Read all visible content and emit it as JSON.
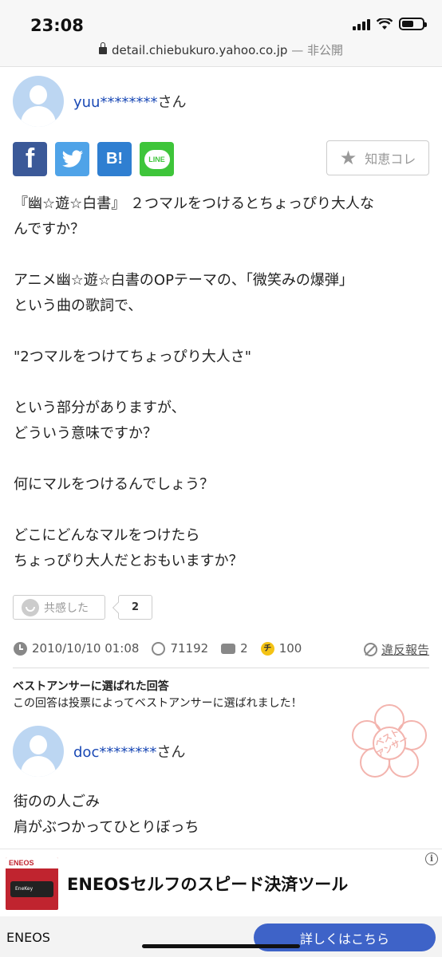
{
  "status_bar": {
    "time": "23:08"
  },
  "url_bar": {
    "domain": "detail.chiebukuro.yahoo.co.jp",
    "suffix": "— 非公開"
  },
  "question": {
    "user_id": "yuu********",
    "honorific": "さん",
    "chie_button_label": "知恵コレ",
    "share_labels": {
      "facebook": "f",
      "twitter": "t",
      "hatena": "B!",
      "line": "LINE"
    },
    "paragraphs": [
      [
        "『幽☆遊☆白書』 ２つマルをつけるとちょっぴり大人な",
        "んですか？"
      ],
      [
        "アニメ幽☆遊☆白書のOPテーマの、「微笑みの爆弾」",
        "という曲の歌詞で、"
      ],
      [
        "\"2つマルをつけてちょっぴり大人さ\""
      ],
      [
        "という部分がありますが、",
        "どういう意味ですか？"
      ],
      [
        "何にマルをつけるんでしょう？"
      ],
      [
        "どこにどんなマルをつけたら",
        "ちょっぴり大人だとおもいますか？"
      ]
    ],
    "empathy_label": "共感した",
    "empathy_count": "2",
    "date": "2010/10/10 01:08",
    "views": "71192",
    "answers": "2",
    "coin_symbol": "チ",
    "coins": "100",
    "report_label": "違反報告"
  },
  "best_answer": {
    "title": "ベストアンサーに選ばれた回答",
    "subtitle": "この回答は投票によってベストアンサーに選ばれました！",
    "user_id": "doc********",
    "honorific": "さん",
    "stamp_text": "ベスト\nアンサー",
    "lines": [
      "街のの人ごみ",
      "肩がぶつかってひとりぼっち"
    ]
  },
  "ad": {
    "title": "ENEOSセルフのスピード決済ツール",
    "brand": "ENEOS",
    "cta": "詳しくはこちら",
    "image_brand": "ENEOS",
    "image_card": "EneKey",
    "info_icon": "i"
  },
  "colors": {
    "link": "#1a49b5",
    "cta": "#3e63c8",
    "stamp": "#f3b4ae"
  }
}
